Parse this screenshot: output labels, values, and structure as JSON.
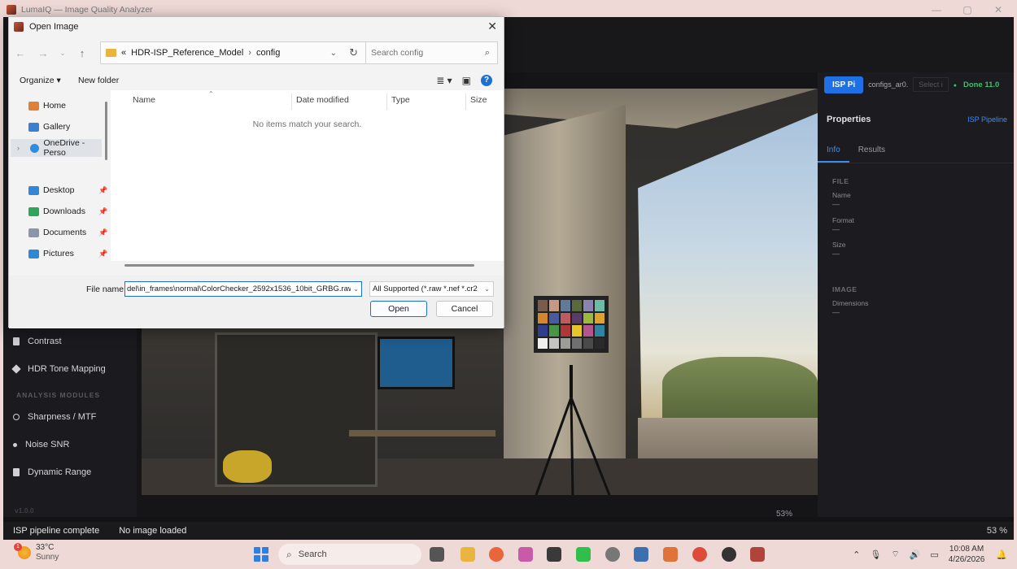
{
  "app": {
    "title": "LumaIQ — Image Quality Analyzer",
    "window_controls": [
      "—",
      "▢",
      "✕"
    ]
  },
  "left_panel": {
    "items": [
      {
        "label": "Contrast",
        "icon": "bar-icon"
      },
      {
        "label": "HDR Tone Mapping",
        "icon": "diamond-icon"
      }
    ],
    "analysis_section": "ANALYSIS MODULES",
    "analysis_items": [
      {
        "label": "Sharpness / MTF",
        "icon": "circle-icon"
      },
      {
        "label": "Noise  SNR",
        "icon": "dot-icon"
      },
      {
        "label": "Dynamic Range",
        "icon": "bar-icon"
      }
    ],
    "footer_faint": "v1.0.0"
  },
  "viewer": {
    "zoom": "53%"
  },
  "right_panel": {
    "isp_button": "ISP Pi",
    "config_name": "configs_ar0.",
    "select_placeholder": "Select i",
    "status": "Done  11.0",
    "title": "Properties",
    "pipeline_link": "ISP Pipeline",
    "tabs": [
      "Info",
      "Results"
    ],
    "file_section": "FILE",
    "fields": [
      {
        "label": "Name",
        "value": "—"
      },
      {
        "label": "Format",
        "value": "—"
      },
      {
        "label": "Size",
        "value": "—"
      }
    ],
    "image_section": "IMAGE",
    "image_fields": [
      {
        "label": "Dimensions",
        "value": "—"
      }
    ]
  },
  "statusbar": {
    "pipeline": "ISP pipeline complete",
    "image": "No image loaded",
    "zoom": "53 %"
  },
  "dialog": {
    "title": "Open Image",
    "close": "✕",
    "breadcrumb": [
      "«",
      "HDR-ISP_Reference_Model",
      "config"
    ],
    "search_placeholder": "Search config",
    "organize": "Organize ▾",
    "new_folder": "New folder",
    "nav_items": [
      {
        "label": "Home",
        "color": "#e0803a"
      },
      {
        "label": "Gallery",
        "color": "#3a7fd0"
      },
      {
        "label": "OneDrive - Perso",
        "color": "#2d8de0"
      },
      {
        "label": "Desktop",
        "color": "#2f87d6"
      },
      {
        "label": "Downloads",
        "color": "#2fa45a"
      },
      {
        "label": "Documents",
        "color": "#8a96a8"
      },
      {
        "label": "Pictures",
        "color": "#2f87d6"
      }
    ],
    "columns": [
      "Name",
      "Date modified",
      "Type",
      "Size"
    ],
    "empty_message": "No items match your search.",
    "file_name_label": "File name:",
    "file_name_value": "del\\in_frames\\normal\\ColorChecker_2592x1536_10bit_GRBG.raw",
    "filter_value": "All Supported (*.raw *.nef *.cr2",
    "open_button": "Open",
    "cancel_button": "Cancel"
  },
  "taskbar": {
    "weather_temp": "33°C",
    "weather_cond": "Sunny",
    "weather_badge": "1",
    "search": "Search",
    "time": "10:08 AM",
    "date": "4/26/2026"
  },
  "colors": {
    "accent": "#1f6fe5",
    "success": "#34c26a",
    "dialog_primary": "#1f6fd0"
  }
}
